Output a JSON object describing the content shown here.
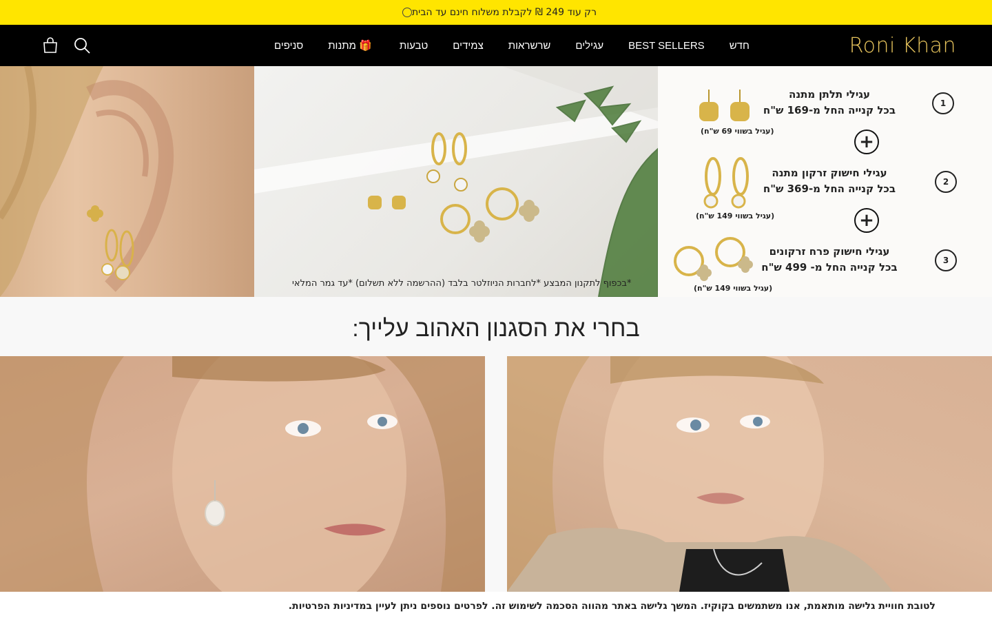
{
  "announcement": {
    "text": "רק עוד 249 ₪ לקבלת משלוח חינם עד הבית",
    "icon": "progress-circle-icon"
  },
  "header": {
    "logo": {
      "text": "Roni Khan",
      "color": "#e6c35c"
    },
    "nav": [
      {
        "label": "חדש"
      },
      {
        "label": "BEST SELLERS"
      },
      {
        "label": "עגילים"
      },
      {
        "label": "שרשראות"
      },
      {
        "label": "צמידים"
      },
      {
        "label": "טבעות"
      },
      {
        "label": "מתנות",
        "icon": "🎁"
      },
      {
        "label": "סניפים"
      }
    ],
    "icons": [
      "search-icon",
      "shopping-bag-icon"
    ]
  },
  "hero": {
    "caption": "*בכפוף לתקנון המבצע *לחברות הניוזלטר בלבד (ההרשמה ללא תשלום) *עד גמר המלאי",
    "promo": [
      {
        "num": "1",
        "line1": "עגילי תלתן מתנה",
        "line2": "בכל קנייה החל מ-169 ש\"ח",
        "value": "(עגיל בשווי 69 ש\"ח)"
      },
      {
        "num": "2",
        "line1": "עגילי חישוק זרקון מתנה",
        "line2": "בכל קנייה החל מ-369 ש\"ח",
        "value": "(עגיל בשווי 149 ש\"ח)"
      },
      {
        "num": "3",
        "line1": "עגילי חישוק פרח זרקונים",
        "line2": "בכל קנייה החל מ- 499 ש\"ח",
        "value": "(עגיל בשווי 149 ש\"ח)"
      }
    ]
  },
  "section": {
    "title": "בחרי את הסגנון האהוב עלייך:"
  },
  "cookie": {
    "text": "לטובת חוויית גלישה מותאמת, אנו משתמשים בקוקיז. המשך גלישה באתר מהווה הסכמה לשימוש זה. לפרטים נוספים ניתן לעיין במדיניות הפרטיות."
  },
  "colors": {
    "announce": "#ffe500",
    "header": "#000000",
    "gold": "#e6c35c"
  }
}
